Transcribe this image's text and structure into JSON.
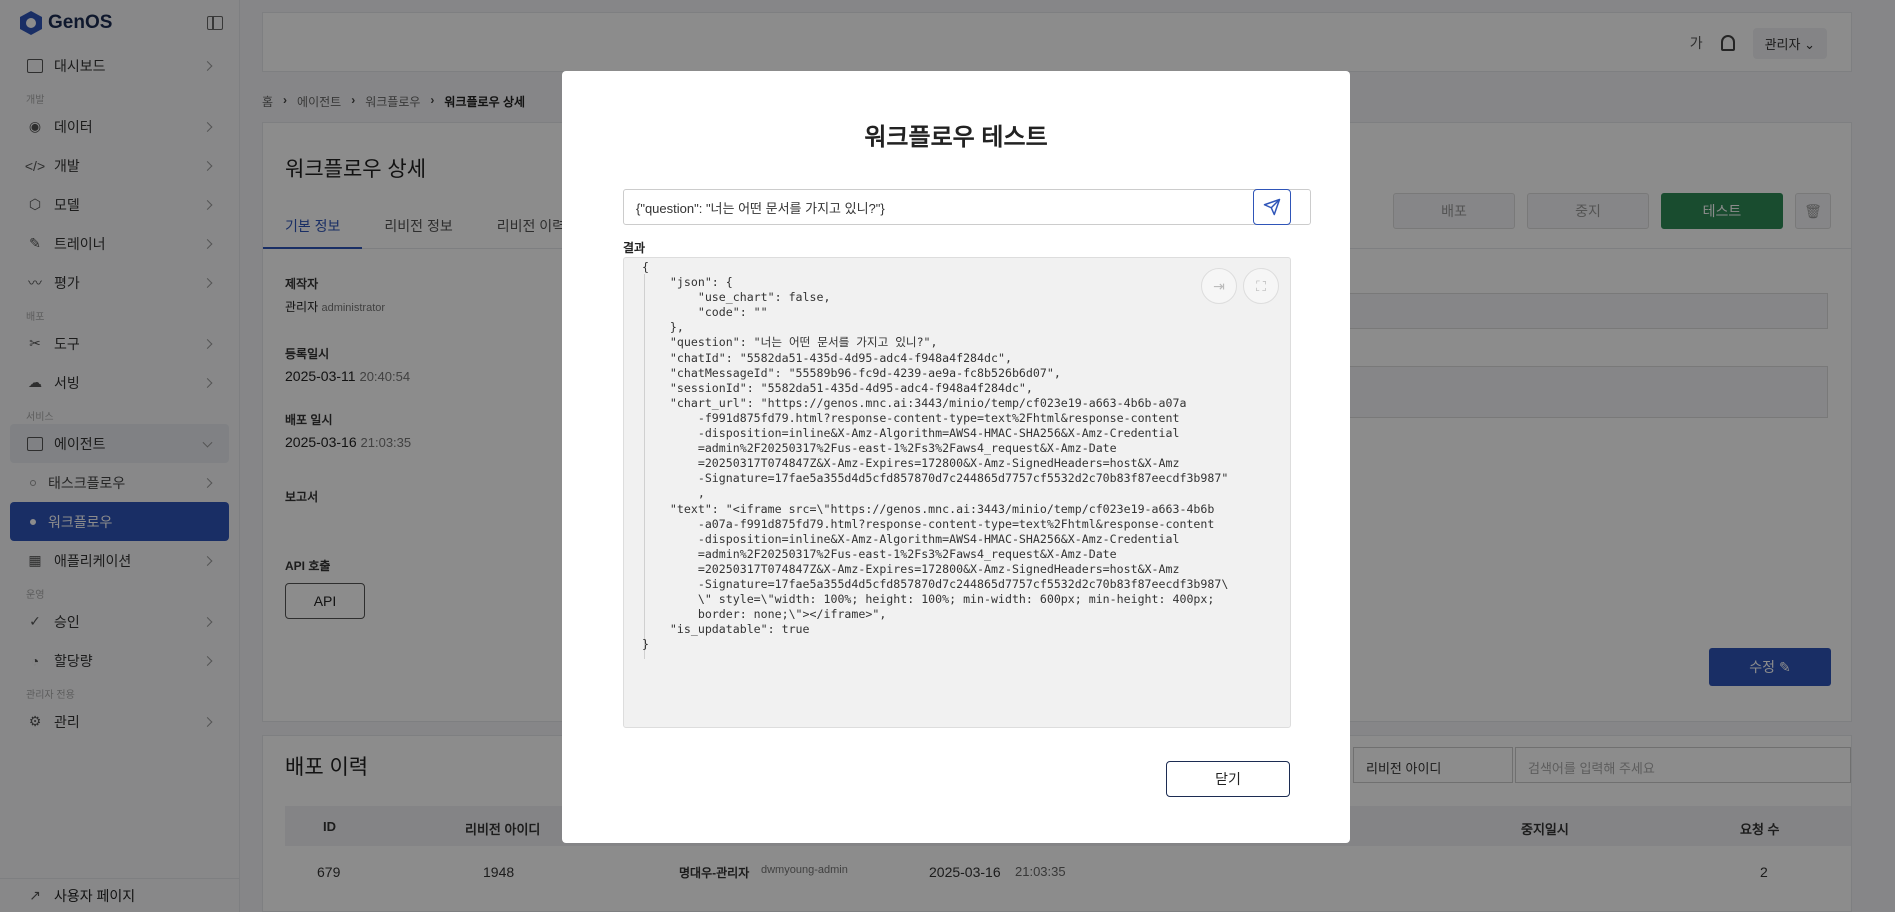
{
  "sidebar": {
    "logo": "GenOS",
    "items": [
      {
        "label": "대시보드"
      },
      {
        "section": "개발"
      },
      {
        "label": "데이터"
      },
      {
        "label": "개발"
      },
      {
        "label": "모델"
      },
      {
        "label": "트레이너"
      },
      {
        "label": "평가"
      },
      {
        "section": "배포"
      },
      {
        "label": "도구"
      },
      {
        "label": "서빙"
      },
      {
        "section": "서비스"
      },
      {
        "label": "에이전트"
      },
      {
        "label": "태스크플로우"
      },
      {
        "label": "워크플로우"
      },
      {
        "label": "애플리케이션"
      },
      {
        "section": "운영"
      },
      {
        "label": "승인"
      },
      {
        "label": "할당량"
      },
      {
        "section": "관리자 전용"
      },
      {
        "label": "관리"
      }
    ],
    "bottom": "사용자 페이지"
  },
  "header": {
    "lang": "가",
    "user": "관리자"
  },
  "breadcrumb": [
    "홈",
    "에이전트",
    "워크플로우",
    "워크플로우 상세"
  ],
  "page": {
    "title": "워크플로우 상세",
    "tabs": [
      "기본 정보",
      "리비전 정보",
      "리비전 이력"
    ],
    "actions": {
      "deploy": "배포",
      "stop": "중지",
      "test": "테스트"
    },
    "creator_label": "제작자",
    "creator": "관리자",
    "creator_id": "administrator",
    "registered_label": "등록일시",
    "registered_date": "2025-03-11",
    "registered_time": "20:40:54",
    "deployed_label": "배포 일시",
    "deployed_date": "2025-03-16",
    "deployed_time": "21:03:35",
    "report_label": "보고서",
    "api_label": "API 호출",
    "api_button": "API",
    "edit_button": "수정"
  },
  "history": {
    "title": "배포 이력",
    "filter": "리비전 아이디",
    "search_placeholder": "검색어를 입력해 주세요",
    "columns": [
      "ID",
      "리비전 아이디",
      "중지일시",
      "요청 수"
    ],
    "row": {
      "id": "679",
      "revision": "1948",
      "deployer": "명대우-관리자",
      "deployer_id": "dwmyoung-admin",
      "date": "2025-03-16",
      "time": "21:03:35",
      "requests": "2"
    }
  },
  "modal": {
    "title": "워크플로우 테스트",
    "input_value": "{\"question\": \"너는 어떤 문서를 가지고 있니?\"}",
    "result_label": "결과",
    "result_text": "{\n    \"json\": {\n        \"use_chart\": false,\n        \"code\": \"\"\n    },\n    \"question\": \"너는 어떤 문서를 가지고 있니?\",\n    \"chatId\": \"5582da51-435d-4d95-adc4-f948a4f284dc\",\n    \"chatMessageId\": \"55589b96-fc9d-4239-ae9a-fc8b526b6d07\",\n    \"sessionId\": \"5582da51-435d-4d95-adc4-f948a4f284dc\",\n    \"chart_url\": \"https://genos.mnc.ai:3443/minio/temp/cf023e19-a663-4b6b-a07a\n        -f991d875fd79.html?response-content-type=text%2Fhtml&response-content\n        -disposition=inline&X-Amz-Algorithm=AWS4-HMAC-SHA256&X-Amz-Credential\n        =admin%2F20250317%2Fus-east-1%2Fs3%2Faws4_request&X-Amz-Date\n        =20250317T074847Z&X-Amz-Expires=172800&X-Amz-SignedHeaders=host&X-Amz\n        -Signature=17fae5a355d4d5cfd857870d7c244865d7757cf5532d2c70b83f87eecdf3b987\"\n        ,\n    \"text\": \"<iframe src=\\\"https://genos.mnc.ai:3443/minio/temp/cf023e19-a663-4b6b\n        -a07a-f991d875fd79.html?response-content-type=text%2Fhtml&response-content\n        -disposition=inline&X-Amz-Algorithm=AWS4-HMAC-SHA256&X-Amz-Credential\n        =admin%2F20250317%2Fus-east-1%2Fs3%2Faws4_request&X-Amz-Date\n        =20250317T074847Z&X-Amz-Expires=172800&X-Amz-SignedHeaders=host&X-Amz\n        -Signature=17fae5a355d4d5cfd857870d7c244865d7757cf5532d2c70b83f87eecdf3b987\\\n        \\\" style=\\\"width: 100%; height: 100%; min-width: 600px; min-height: 400px;\n        border: none;\\\"></iframe>\",\n    \"is_updatable\": true\n}",
    "close_button": "닫기"
  }
}
